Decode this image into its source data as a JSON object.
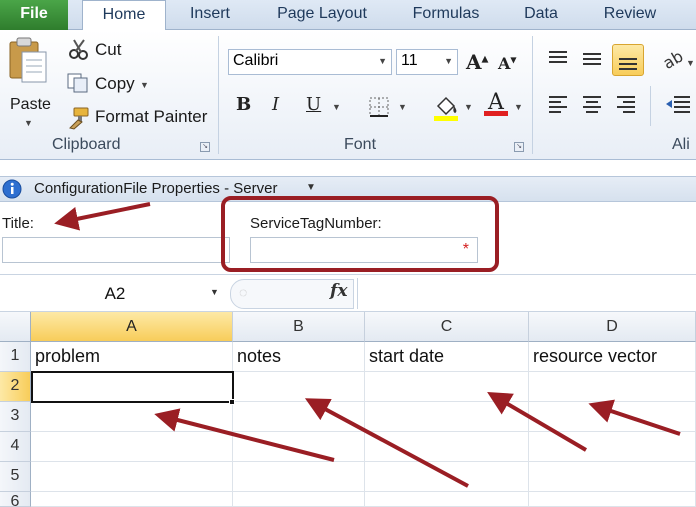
{
  "tabs": [
    "File",
    "Home",
    "Insert",
    "Page Layout",
    "Formulas",
    "Data",
    "Review"
  ],
  "clipboard": {
    "paste": "Paste",
    "cut": "Cut",
    "copy": "Copy",
    "format_painter": "Format Painter",
    "group_label": "Clipboard"
  },
  "font": {
    "family": "Calibri",
    "size": "11",
    "bold": "B",
    "italic": "I",
    "underline": "U",
    "grow": "A",
    "shrink": "A",
    "font_color": "A",
    "group_label": "Font"
  },
  "alignment": {
    "group_label": "Ali"
  },
  "properties": {
    "header": "ConfigurationFile Properties - Server",
    "title_label": "Title:",
    "title_value": "",
    "service_tag_label": "ServiceTagNumber:",
    "service_tag_value": "",
    "required_mark": "*"
  },
  "formula_bar": {
    "name_box": "A2",
    "fx": "fx",
    "content": ""
  },
  "sheet": {
    "columns": [
      "A",
      "B",
      "C",
      "D"
    ],
    "rows": [
      "1",
      "2",
      "3",
      "4",
      "5",
      "6"
    ],
    "row1": [
      "problem",
      "notes",
      "start date",
      "resource vector"
    ]
  },
  "colors": {
    "file_tab": "#2f7d2d",
    "annotation": "#9a1e24",
    "selected_header": "#f8cd5a"
  }
}
